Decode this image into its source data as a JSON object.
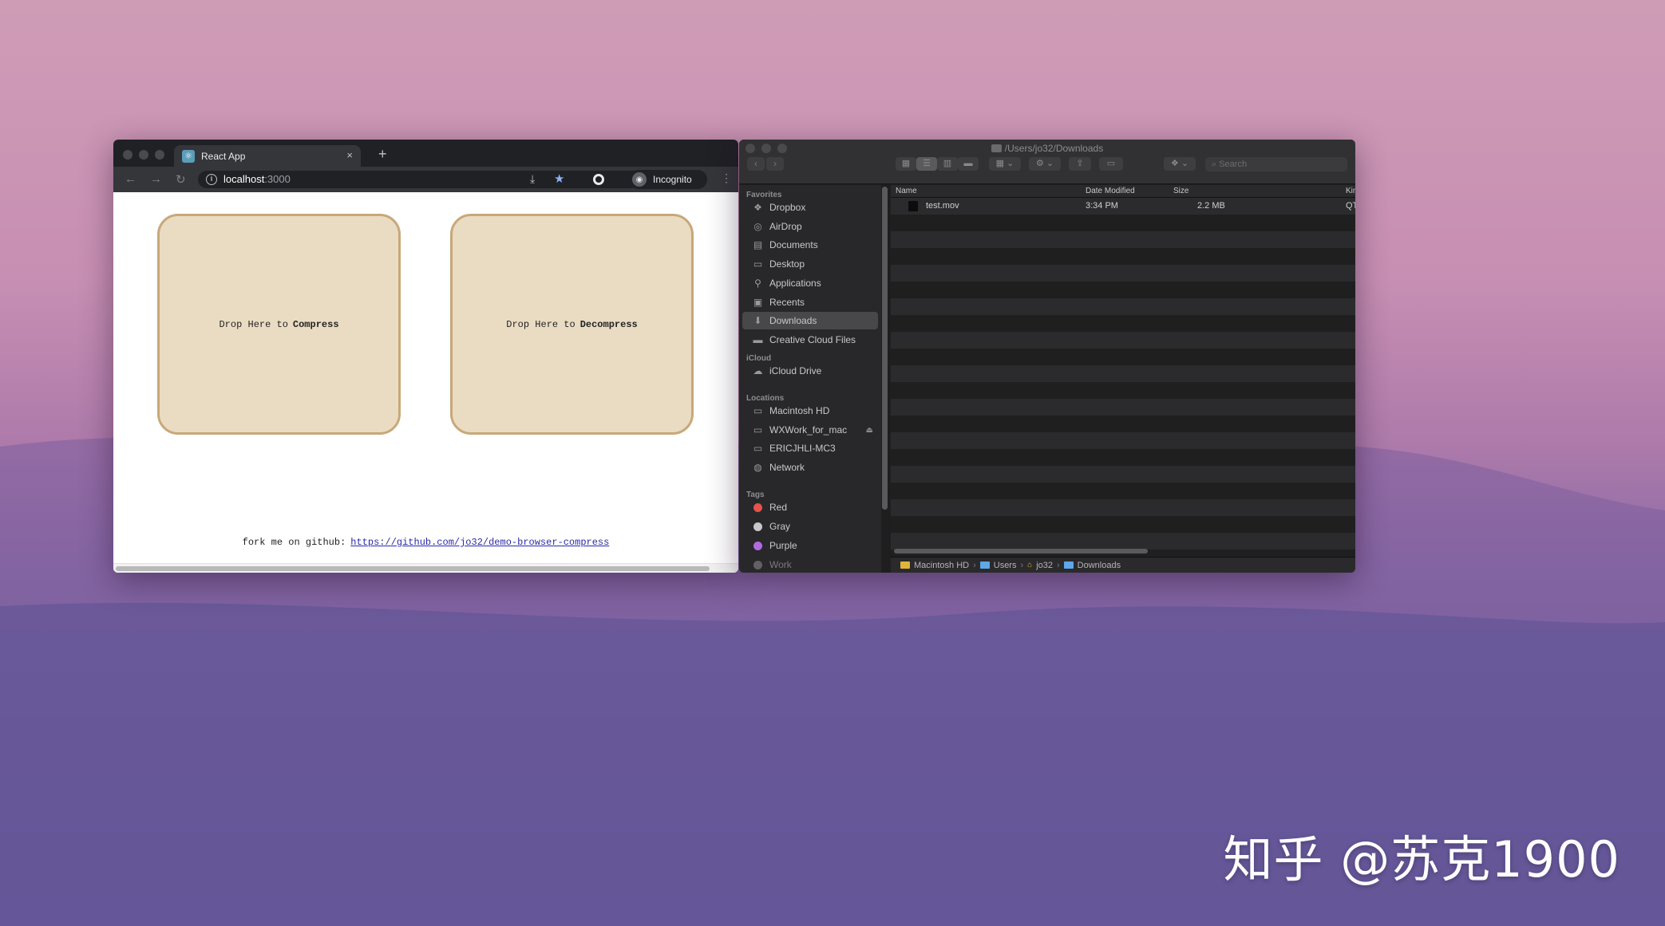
{
  "browser": {
    "tab_title": "React App",
    "tab_close": "×",
    "new_tab": "+",
    "url_host": "localhost",
    "url_port": ":3000",
    "incognito_label": "Incognito",
    "menu_icon": "⋮",
    "compress_prefix": "Drop Here to",
    "compress_action": "Compress",
    "decompress_prefix": "Drop Here to",
    "decompress_action": "Decompress",
    "fork_text": "fork me on github:",
    "fork_link": "https://github.com/jo32/demo-browser-compress"
  },
  "finder": {
    "title": "/Users/jo32/Downloads",
    "search_placeholder": "Search",
    "sidebar": {
      "favorites_heading": "Favorites",
      "favorites": [
        {
          "label": "Dropbox",
          "icon": "dropbox-icon"
        },
        {
          "label": "AirDrop",
          "icon": "airdrop-icon"
        },
        {
          "label": "Documents",
          "icon": "documents-icon"
        },
        {
          "label": "Desktop",
          "icon": "desktop-icon"
        },
        {
          "label": "Applications",
          "icon": "applications-icon"
        },
        {
          "label": "Recents",
          "icon": "recents-icon"
        },
        {
          "label": "Downloads",
          "icon": "downloads-icon"
        },
        {
          "label": "Creative Cloud Files",
          "icon": "folder-icon"
        }
      ],
      "icloud_heading": "iCloud",
      "icloud": [
        {
          "label": "iCloud Drive",
          "icon": "cloud-icon"
        }
      ],
      "locations_heading": "Locations",
      "locations": [
        {
          "label": "Macintosh HD",
          "icon": "disk-icon"
        },
        {
          "label": "WXWork_for_mac",
          "icon": "disk-icon"
        },
        {
          "label": "ERICJHLI-MC3",
          "icon": "computer-icon"
        },
        {
          "label": "Network",
          "icon": "network-icon"
        }
      ],
      "tags_heading": "Tags",
      "tags": [
        {
          "label": "Red",
          "color": "#e5534b"
        },
        {
          "label": "Gray",
          "color": "#c8c8cc"
        },
        {
          "label": "Purple",
          "color": "#b26ae0"
        },
        {
          "label": "Work",
          "color": "#9a9a9e"
        }
      ]
    },
    "columns": {
      "name": "Name",
      "date": "Date Modified",
      "size": "Size",
      "kind": "Kin"
    },
    "files": [
      {
        "name": "test.mov",
        "date": "3:34 PM",
        "size": "2.2 MB",
        "kind": "QT"
      }
    ],
    "path": [
      "Macintosh HD",
      "Users",
      "jo32",
      "Downloads"
    ]
  },
  "watermark": "知乎 @苏克1900"
}
